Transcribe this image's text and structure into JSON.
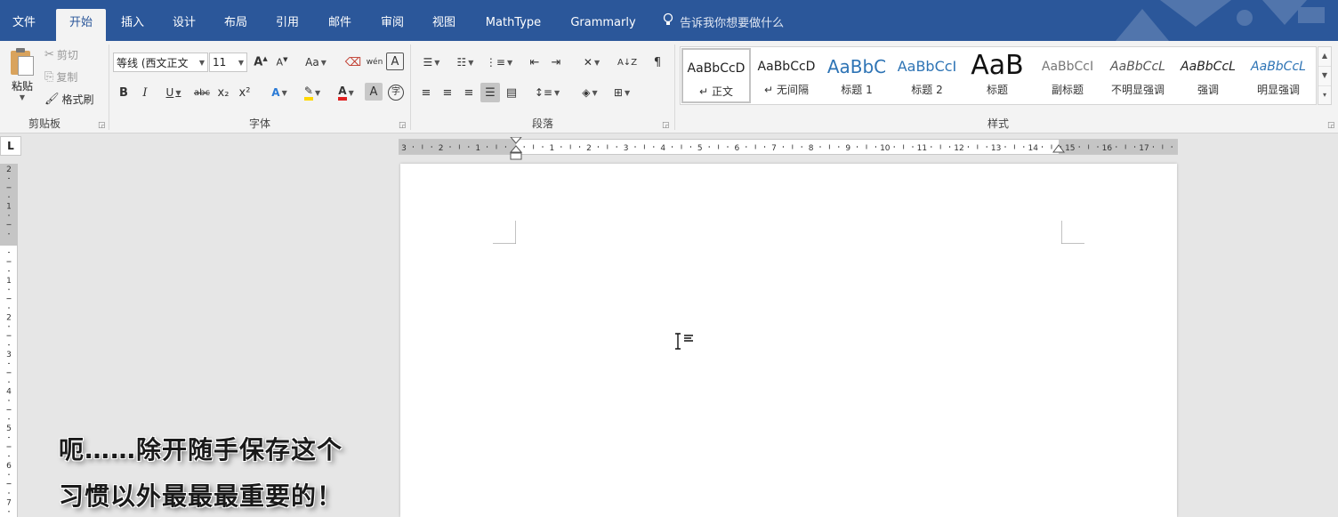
{
  "tabs": [
    {
      "label": "文件",
      "active": false
    },
    {
      "label": "开始",
      "active": true
    },
    {
      "label": "插入",
      "active": false
    },
    {
      "label": "设计",
      "active": false
    },
    {
      "label": "布局",
      "active": false
    },
    {
      "label": "引用",
      "active": false
    },
    {
      "label": "邮件",
      "active": false
    },
    {
      "label": "审阅",
      "active": false
    },
    {
      "label": "视图",
      "active": false
    },
    {
      "label": "MathType",
      "active": false
    },
    {
      "label": "Grammarly",
      "active": false
    }
  ],
  "tell_me": "告诉我你想要做什么",
  "clipboard": {
    "paste": "粘贴",
    "cut": "剪切",
    "copy": "复制",
    "format_painter": "格式刷",
    "group_label": "剪贴板"
  },
  "font": {
    "font_name": "等线 (西文正文",
    "font_size": "11",
    "case_label": "Aa",
    "bold": "B",
    "italic": "I",
    "underline": "U",
    "strikethrough": "abc",
    "subscript": "x₂",
    "superscript": "x²",
    "pinyin": "wén",
    "font_color_label": "A",
    "group_label": "字体"
  },
  "paragraph": {
    "group_label": "段落"
  },
  "styles": {
    "items": [
      {
        "sample": "AaBbCcD",
        "name": "正文",
        "mark": "↵",
        "selected": true
      },
      {
        "sample": "AaBbCcD",
        "name": "无间隔",
        "mark": "↵",
        "selected": false
      },
      {
        "sample": "AaBbC",
        "name": "标题 1",
        "mark": "",
        "selected": false
      },
      {
        "sample": "AaBbCcI",
        "name": "标题 2",
        "mark": "",
        "selected": false
      },
      {
        "sample": "AaB",
        "name": "标题",
        "mark": "",
        "selected": false
      },
      {
        "sample": "AaBbCcI",
        "name": "副标题",
        "mark": "",
        "selected": false
      },
      {
        "sample": "AaBbCcL",
        "name": "不明显强调",
        "mark": "",
        "selected": false
      },
      {
        "sample": "AaBbCcL",
        "name": "强调",
        "mark": "",
        "selected": false
      },
      {
        "sample": "AaBbCcL",
        "name": "明显强调",
        "mark": "",
        "selected": false
      }
    ],
    "group_label": "样式"
  },
  "ruler_corner": "L",
  "ruler_numbers": [
    "3",
    "2",
    "1",
    "",
    "1",
    "2",
    "3",
    "4",
    "5",
    "6",
    "7",
    "8",
    "9",
    "10",
    "11",
    "12",
    "13",
    "14",
    "15",
    "16",
    "17"
  ],
  "vruler_numbers": [
    "2",
    "1",
    "",
    "1",
    "2",
    "3",
    "4",
    "5",
    "6",
    "7"
  ],
  "caption": {
    "line1": "呃……除开随手保存这个",
    "line2": "习惯以外最最最重要的！"
  },
  "colors": {
    "brand": "#2b579a",
    "ribbon": "#f3f3f3",
    "highlight": "#ffd800",
    "font_red": "#e02020"
  }
}
